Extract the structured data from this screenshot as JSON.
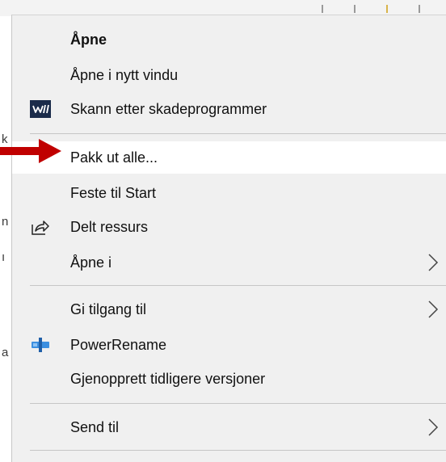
{
  "context_menu": {
    "items": [
      {
        "label": "Åpne",
        "icon": null,
        "submenu": false
      },
      {
        "label": "Åpne i nytt vindu",
        "icon": null,
        "submenu": false
      },
      {
        "label": "Skann etter skadeprogrammer",
        "icon": "malwarebytes-icon",
        "submenu": false
      },
      {
        "label": "Pakk ut alle...",
        "icon": null,
        "submenu": false,
        "highlighted": true
      },
      {
        "label": "Feste til Start",
        "icon": null,
        "submenu": false
      },
      {
        "label": "Delt ressurs",
        "icon": "share-icon",
        "submenu": false
      },
      {
        "label": "Åpne i",
        "icon": null,
        "submenu": true
      },
      {
        "label": "Gi tilgang til",
        "icon": null,
        "submenu": true
      },
      {
        "label": "PowerRename",
        "icon": "powerrename-icon",
        "submenu": false
      },
      {
        "label": "Gjenopprett tidligere versjoner",
        "icon": null,
        "submenu": false
      },
      {
        "label": "Send til",
        "icon": null,
        "submenu": true
      }
    ]
  },
  "annotation": {
    "pointer": "red-arrow-icon",
    "color": "#c00000"
  },
  "background": {
    "fragments": [
      "k",
      "n",
      "ı",
      "a"
    ]
  },
  "colors": {
    "menu_bg": "#f0f0f0",
    "highlight_bg": "#ffffff",
    "separator": "#c6c6c6",
    "powerrename_blue": "#2a7fd4",
    "malwarebytes_bg": "#1a2b4a"
  }
}
